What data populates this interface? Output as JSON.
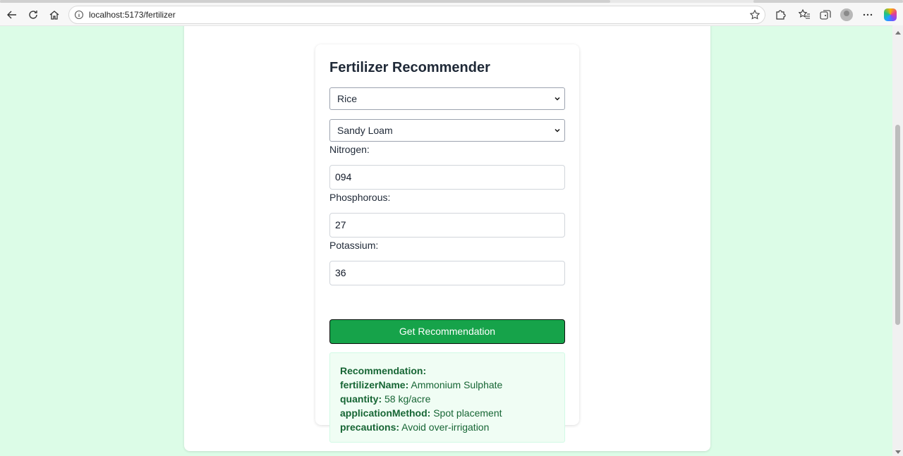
{
  "browser": {
    "url": "localhost:5173/fertilizer"
  },
  "icons": [
    "back-icon",
    "refresh-icon",
    "home-icon",
    "info-icon",
    "star-icon",
    "extensions-icon",
    "favorites-icon",
    "collections-icon",
    "profile-avatar",
    "more-icon",
    "copilot-icon"
  ],
  "form": {
    "title": "Fertilizer Recommender",
    "crop_select": "Rice",
    "soil_select": "Sandy Loam",
    "nitrogen_label": "Nitrogen:",
    "nitrogen_value": "094",
    "phosphorous_label": "Phosphorous:",
    "phosphorous_value": "27",
    "potassium_label": "Potassium:",
    "potassium_value": "36",
    "submit_label": "Get Recommendation"
  },
  "result": {
    "heading": "Recommendation:",
    "fields": [
      {
        "key": "fertilizerName:",
        "value": "Ammonium Sulphate"
      },
      {
        "key": "quantity:",
        "value": "58 kg/acre"
      },
      {
        "key": "applicationMethod:",
        "value": "Spot placement"
      },
      {
        "key": "precautions:",
        "value": "Avoid over-irrigation"
      }
    ]
  },
  "colors": {
    "page_bg": "#dcfce7",
    "button": "#16a34a",
    "result_bg": "#f0fdf4",
    "result_text": "#166534"
  }
}
